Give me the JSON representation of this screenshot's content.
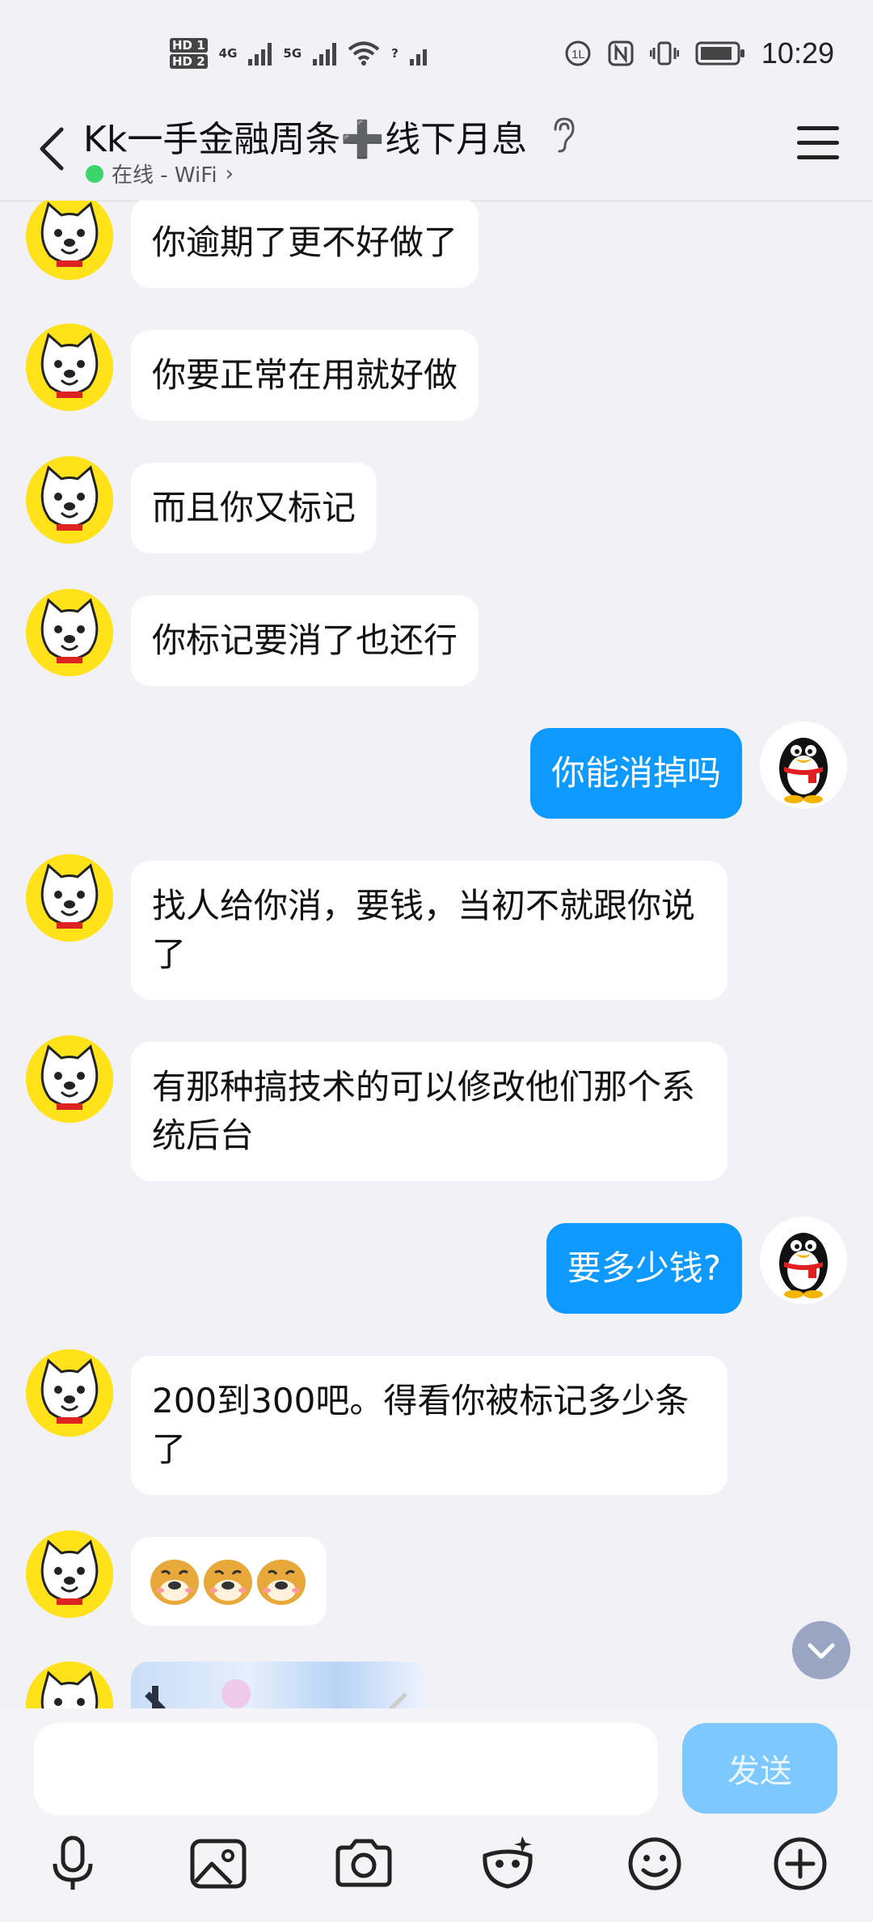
{
  "status": {
    "time": "10:29",
    "hd1": "HD 1",
    "hd2": "HD 2",
    "net1": "4G",
    "net2": "5G",
    "wifi_extra": "?"
  },
  "header": {
    "title_part1": "Kk一手金融周条",
    "title_plus": "➕",
    "title_part2": "线下月息",
    "online_status": "在线 - WiFi",
    "online_chevron": "›"
  },
  "messages": [
    {
      "from": "them",
      "text": "你逾期了更不好做了"
    },
    {
      "from": "them",
      "text": "你要正常在用就好做"
    },
    {
      "from": "them",
      "text": "而且你又标记"
    },
    {
      "from": "them",
      "text": "你标记要消了也还行"
    },
    {
      "from": "me",
      "text": "你能消掉吗"
    },
    {
      "from": "them",
      "text": "找人给你消，要钱，当初不就跟你说了"
    },
    {
      "from": "them",
      "text": "有那种搞技术的可以修改他们那个系统后台"
    },
    {
      "from": "me",
      "text": "要多少钱?"
    },
    {
      "from": "them",
      "text": "200到300吧。得看你被标记多少条了"
    },
    {
      "from": "them",
      "text": "",
      "emoji": "dog-face-emoji x3"
    },
    {
      "from": "them",
      "text": "",
      "image": "sticker-image"
    }
  ],
  "input": {
    "placeholder": "",
    "send_label": "发送"
  },
  "toolbar": [
    "mic-icon",
    "image-icon",
    "camera-icon",
    "sticker-icon",
    "emoji-icon",
    "plus-icon"
  ],
  "colors": {
    "my_bubble": "#0e99ff",
    "their_bubble": "#ffffff",
    "background": "#f1f1f6",
    "send_button": "#7cc8ff",
    "online_dot": "#3ad66b"
  }
}
